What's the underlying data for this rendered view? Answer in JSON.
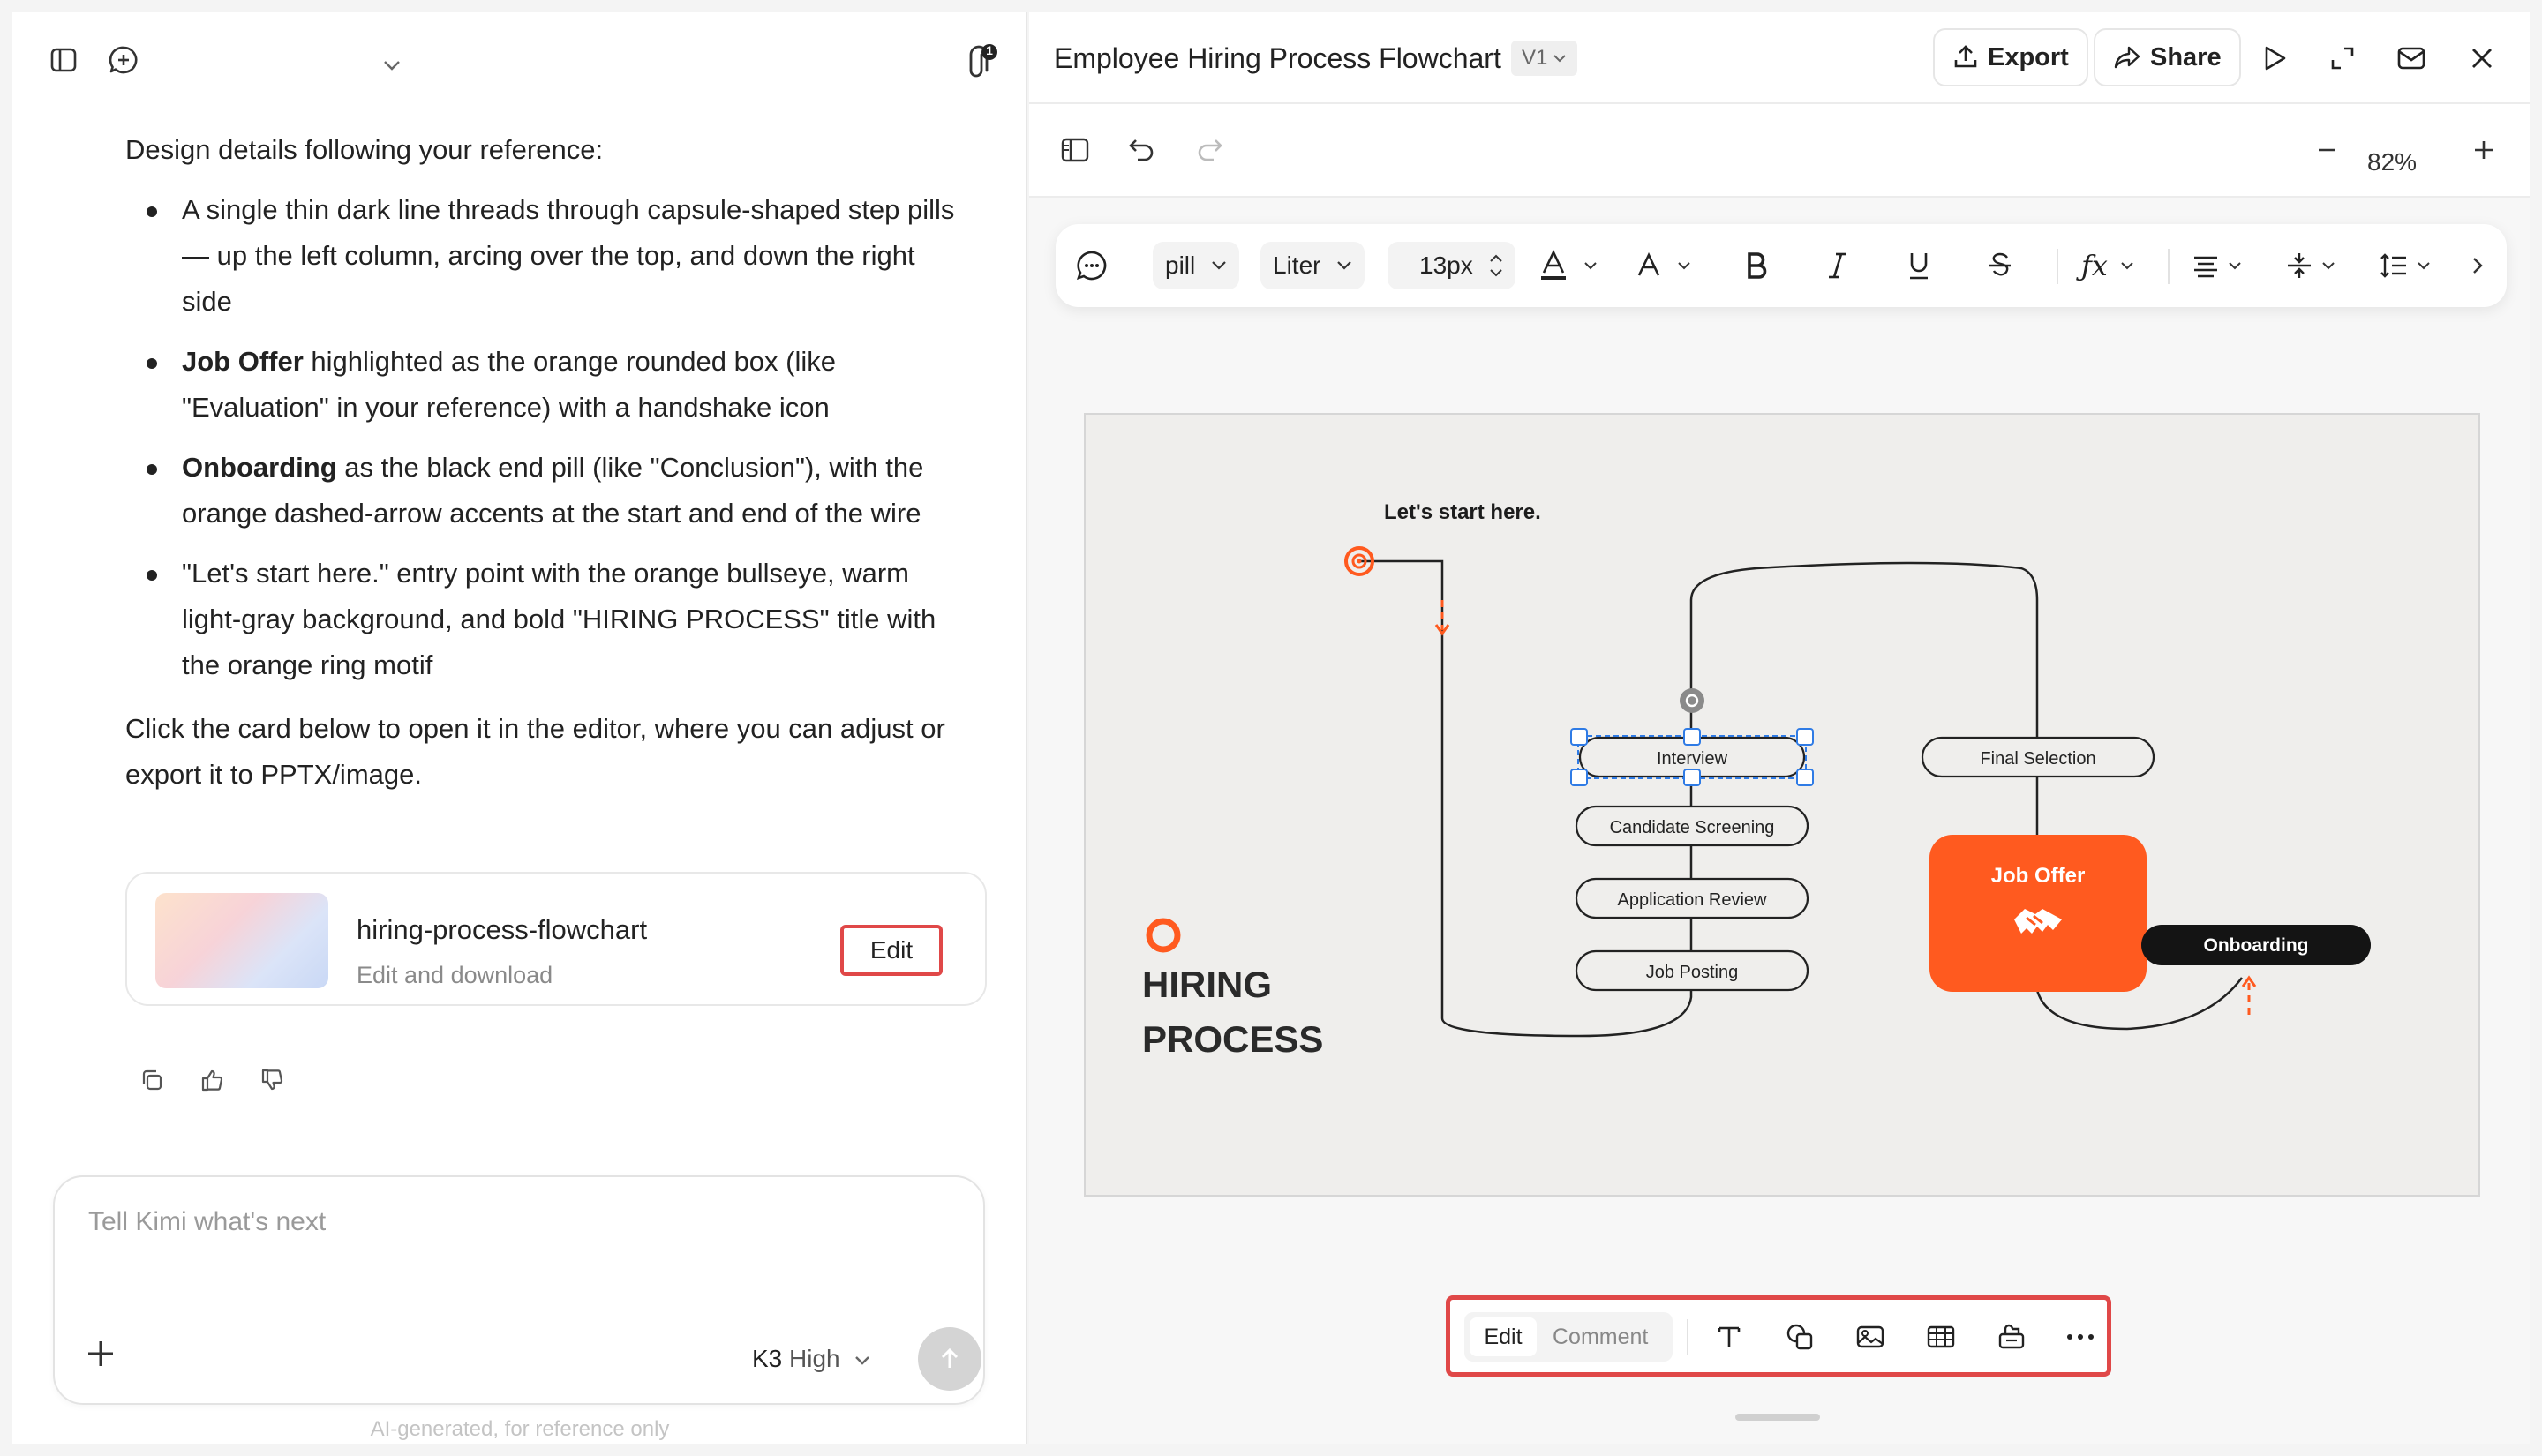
{
  "left_panel": {
    "intro": "Design details following your reference:",
    "bullets": [
      {
        "strong": "",
        "text": "A single thin dark line threads through capsule-shaped step pills — up the left column, arcing over the top, and down the right side"
      },
      {
        "strong": "Job Offer",
        "text": " highlighted as the orange rounded box (like \"Evaluation\" in your reference) with a handshake icon"
      },
      {
        "strong": "Onboarding",
        "text": " as the black end pill (like \"Conclusion\"), with the orange dashed-arrow accents at the start and end of the wire"
      },
      {
        "strong": "",
        "text": "\"Let's start here.\" entry point with the orange bullseye, warm light-gray background, and bold \"HIRING PROCESS\" title with the orange ring motif"
      }
    ],
    "outro": "Click the card below to open it in the editor, where you can adjust or export it to PPTX/image.",
    "card": {
      "title": "hiring-process-flowchart",
      "subtitle": "Edit and download",
      "edit_label": "Edit"
    },
    "attachment_badge": "1",
    "composer": {
      "placeholder": "Tell Kimi what's next",
      "model_name": "K3",
      "model_mode": "High"
    },
    "disclaimer": "AI-generated, for reference only"
  },
  "editor": {
    "title": "Employee Hiring Process Flowchart",
    "version": "V1",
    "export_label": "Export",
    "share_label": "Share",
    "zoom": "82%",
    "format_bar": {
      "shape": "pill",
      "font": "Liter",
      "size": "13px"
    },
    "bottom_toolbar": {
      "edit_label": "Edit",
      "comment_label": "Comment"
    }
  },
  "slide": {
    "start_label": "Let's start here.",
    "title_line1": "HIRING",
    "title_line2": "PROCESS",
    "steps": [
      "Job Posting",
      "Application Review",
      "Candidate Screening",
      "Interview",
      "Final Selection"
    ],
    "highlight": "Job Offer",
    "end": "Onboarding"
  },
  "colors": {
    "accent": "#ff5a1f",
    "highlight_border": "#e04848",
    "selection": "#2f7be5",
    "slide_bg": "#efeeec"
  },
  "icons": [
    "sidebar-toggle-icon",
    "new-chat-icon",
    "chevron-down-icon",
    "paperclip-icon",
    "copy-icon",
    "thumbs-up-icon",
    "thumbs-down-icon",
    "plus-icon",
    "send-arrow-icon",
    "upload-icon",
    "share-icon",
    "play-icon",
    "expand-icon",
    "mail-icon",
    "close-icon",
    "panel-icon",
    "undo-icon",
    "redo-icon",
    "minus-icon",
    "comment-icon",
    "text-icon",
    "shapes-icon",
    "image-icon",
    "table-icon",
    "widget-icon",
    "more-icon",
    "handshake-icon"
  ]
}
